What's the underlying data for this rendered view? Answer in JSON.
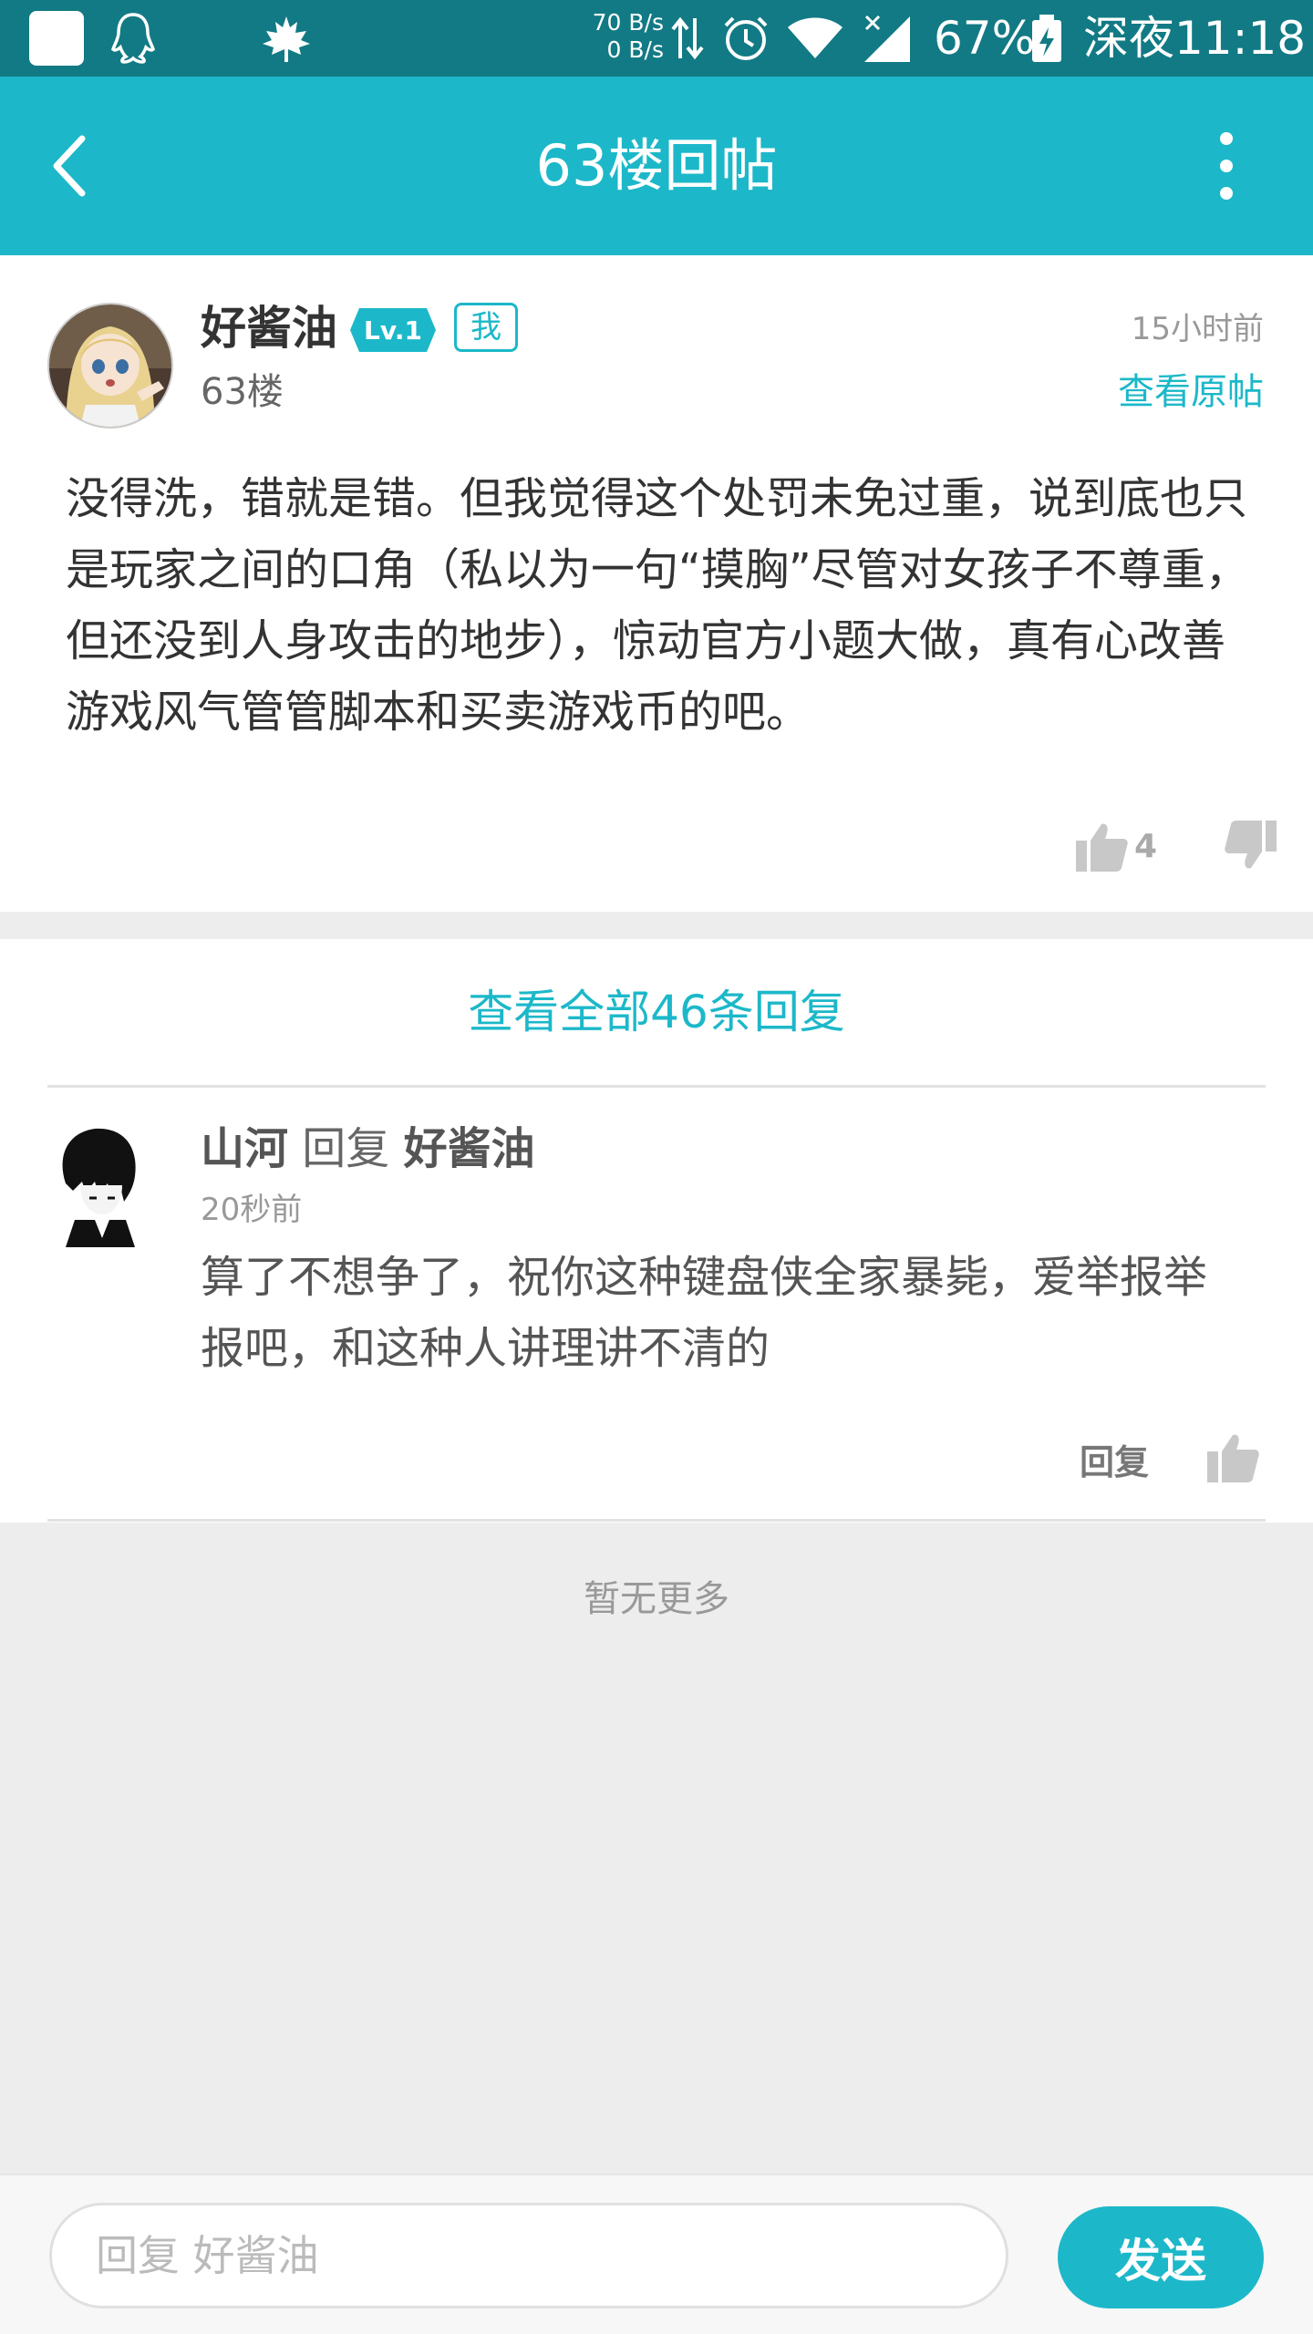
{
  "status_bar": {
    "net_up": "70 B/s",
    "net_down": "0 B/s",
    "battery": "67%",
    "time": "深夜11:18",
    "icons": [
      "app-square-icon",
      "qq-penguin-icon",
      "maple-leaf-icon",
      "data-arrows-icon",
      "alarm-icon",
      "wifi-icon",
      "signal-icon",
      "battery-charging-icon"
    ]
  },
  "header": {
    "title": "63楼回帖",
    "back_icon": "chevron-left-icon",
    "more_icon": "more-vertical-icon",
    "bg_color": "#1cb8c9"
  },
  "post": {
    "username": "好酱油",
    "level": "Lv.1",
    "me_badge": "我",
    "floor": "63楼",
    "time": "15小时前",
    "view_original": "查看原帖",
    "content": "没得洗，错就是错。但我觉得这个处罚未免过重，说到底也只是玩家之间的口角（私以为一句“摸胸”尽管对女孩子不尊重，但还没到人身攻击的地步），惊动官方小题大做，真有心改善游戏风气管管脚本和买卖游戏币的吧。",
    "likes": "4"
  },
  "replies": {
    "view_all": "查看全部46条回复",
    "items": [
      {
        "author": "山河",
        "reply_word": "回复",
        "target": "好酱油",
        "time": "20秒前",
        "text": "算了不想争了，祝你这种键盘侠全家暴毙，爱举报举报吧，和这种人讲理讲不清的",
        "reply_label": "回复"
      }
    ]
  },
  "no_more": "暂无更多",
  "bottom_bar": {
    "placeholder": "回复 好酱油",
    "send": "发送"
  }
}
